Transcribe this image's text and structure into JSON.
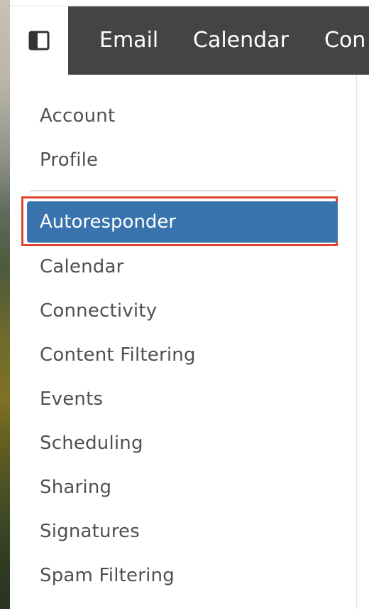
{
  "topnav": {
    "toggle_icon": "sidebar-toggle-icon",
    "tabs": [
      {
        "label": "Email"
      },
      {
        "label": "Calendar"
      },
      {
        "label": "Con"
      }
    ]
  },
  "sidebar": {
    "items": [
      {
        "label": "Account"
      },
      {
        "label": "Profile"
      }
    ],
    "active_item": "Autoresponder",
    "settings_items": [
      {
        "label": "Calendar"
      },
      {
        "label": "Connectivity"
      },
      {
        "label": "Content Filtering"
      },
      {
        "label": "Events"
      },
      {
        "label": "Scheduling"
      },
      {
        "label": "Sharing"
      },
      {
        "label": "Signatures"
      },
      {
        "label": "Spam Filtering"
      }
    ]
  },
  "colors": {
    "topnav_bg": "#444444",
    "active_bg": "#3974ae",
    "highlight_border": "#e0442d",
    "text": "#505050"
  }
}
